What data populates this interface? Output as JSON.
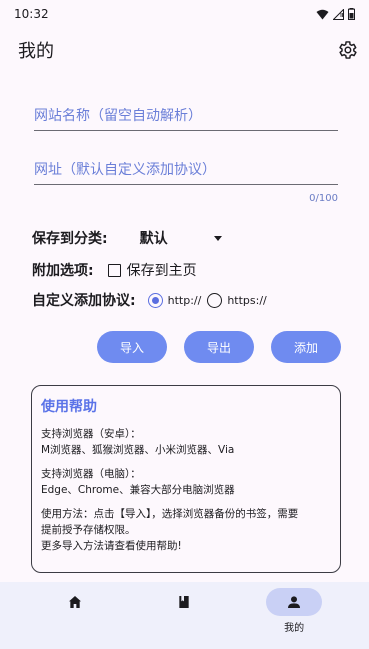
{
  "status": {
    "time": "10:32"
  },
  "app_bar": {
    "title": "我的",
    "settings_icon": "gear-icon"
  },
  "form": {
    "name_placeholder": "网站名称（留空自动解析）",
    "url_placeholder": "网址（默认自定义添加协议）",
    "counter": "0/100",
    "category_label": "保存到分类:",
    "category_value": "默认",
    "extra_label": "附加选项:",
    "save_home_label": "保存到主页",
    "save_home_checked": false,
    "protocol_label": "自定义添加协议:",
    "protocol_options": [
      "http://",
      "https://"
    ],
    "protocol_selected": "http://"
  },
  "actions": {
    "import": "导入",
    "export": "导出",
    "add": "添加"
  },
  "help": {
    "title": "使用帮助",
    "android_head": "支持浏览器（安卓）：",
    "android_list": "M浏览器、狐猴浏览器、小米浏览器、Via",
    "pc_head": "支持浏览器（电脑）：",
    "pc_list": "Edge、Chrome、兼容大部分电脑浏览器",
    "usage_1": "使用方法：点击【导入】，选择浏览器备份的书签，需要",
    "usage_2": "提前授予存储权限。",
    "usage_3": "更多导入方法请查看使用帮助!"
  },
  "nav": {
    "items": [
      {
        "icon": "home-icon",
        "label": ""
      },
      {
        "icon": "book-icon",
        "label": ""
      },
      {
        "icon": "person-icon",
        "label": "我的",
        "active": true
      }
    ]
  },
  "colors": {
    "accent": "#6f8bf0",
    "nav_bg": "#eff0fb",
    "active_pill": "#c9d0f5"
  }
}
